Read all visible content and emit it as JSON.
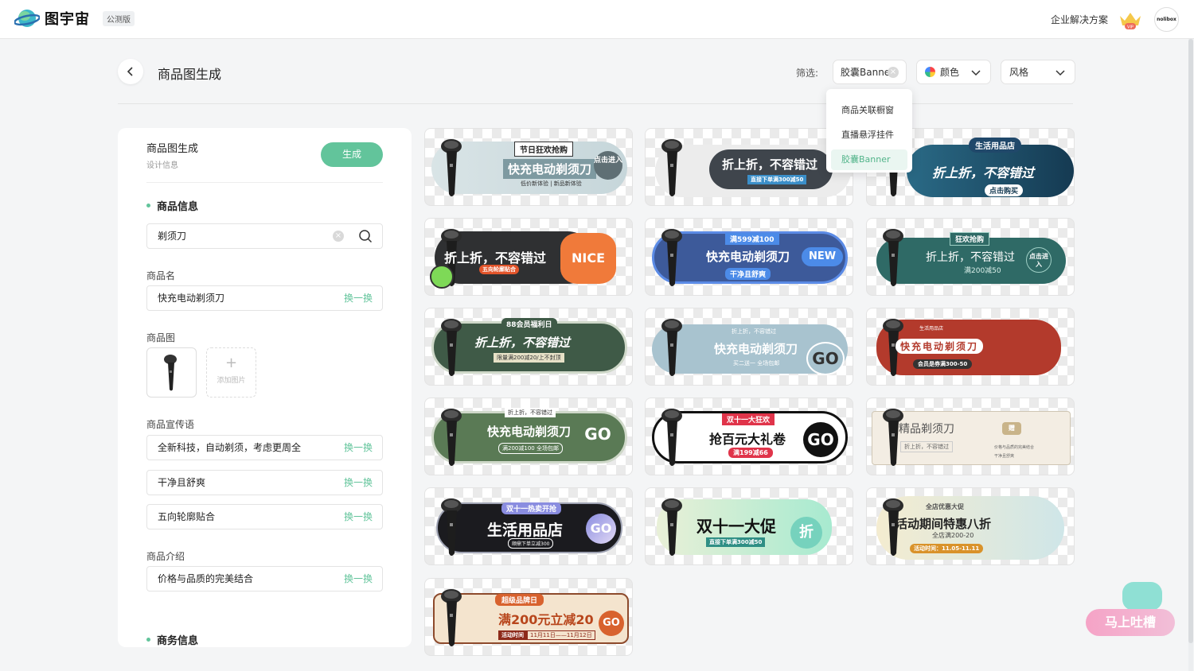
{
  "header": {
    "brand": "图宇宙",
    "beta": "公测版",
    "enterprise": "企业解决方案",
    "vip": "VIP",
    "avatar": "nolibox"
  },
  "page": {
    "title": "商品图生成"
  },
  "filters": {
    "label": "筛选:",
    "type": "胶囊Banner",
    "color": "颜色",
    "style": "风格"
  },
  "dropdown": {
    "items": [
      "商品关联橱窗",
      "直播悬浮挂件",
      "胶囊Banner"
    ]
  },
  "panel": {
    "title": "商品图生成",
    "subtitle": "设计信息",
    "generate": "生成",
    "section_product": "商品信息",
    "search_value": "剃须刀",
    "name_label": "商品名",
    "name_value": "快充电动剃须刀",
    "swap": "换一换",
    "image_label": "商品图",
    "add_image": "添加图片",
    "slogan_label": "商品宣传语",
    "slogans": [
      "全新科技，自动剃须，考虑更周全",
      "干净且舒爽",
      "五向轮廓贴合"
    ],
    "intro_label": "商品介绍",
    "intro_value": "价格与品质的完美结合",
    "section_business": "商务信息"
  },
  "cards": [
    {
      "lines": [
        "节日狂欢抢购",
        "快充电动剃须刀",
        "低价新体验 | 新品新体验"
      ],
      "go": "点击进入"
    },
    {
      "lines": [
        "折上折，不容错过",
        "直接下单满300减50"
      ],
      "go": ""
    },
    {
      "lines": [
        "生活用品店",
        "折上折，不容错过",
        "点击购买"
      ],
      "go": ""
    },
    {
      "lines": [
        "折上折，不容错过",
        "五向轮廓贴合"
      ],
      "go": "NICE"
    },
    {
      "lines": [
        "满599减100",
        "快充电动剃须刀",
        "干净且舒爽"
      ],
      "go": "NEW"
    },
    {
      "lines": [
        "狂欢抢购",
        "折上折，不容错过",
        "满200减50"
      ],
      "go": "点击进入"
    },
    {
      "lines": [
        "88会员福利日",
        "折上折，不容错过",
        "限量满200减20/上不封顶"
      ],
      "go": ""
    },
    {
      "lines": [
        "折上折，不容错过",
        "快充电动剃须刀",
        "买二送一 全场包邮"
      ],
      "go": "GO"
    },
    {
      "lines": [
        "生活用品店",
        "快充电动剃须刀",
        "会员是券满300-50"
      ],
      "go": ""
    },
    {
      "lines": [
        "折上折，不容错过",
        "快充电动剃须刀",
        "满200减100 全场包邮"
      ],
      "go": "GO"
    },
    {
      "lines": [
        "双十一大狂欢",
        "抢百元大礼卷",
        "满199减66"
      ],
      "go": "GO"
    },
    {
      "lines": [
        "精品剃须刀",
        "折上折，不容错过",
        "价格与品质的完美结合",
        "干净且舒爽"
      ],
      "go": "赠"
    },
    {
      "lines": [
        "双十一热卖开抢",
        "生活用品店",
        "顺鼎下单立减300"
      ],
      "go": "GO"
    },
    {
      "lines": [
        "双十一大促",
        "直接下单满300减50"
      ],
      "go": "折"
    },
    {
      "lines": [
        "全店优惠大促",
        "活动期间特惠八折",
        "全店满200-20",
        "活动时间：11.05-11.11"
      ],
      "go": ""
    },
    {
      "lines": [
        "超级品牌日",
        "满200元立减20",
        "活动时间",
        "11月11日——11月12日"
      ],
      "go": "GO"
    }
  ],
  "helper": {
    "label": "马上吐槽"
  }
}
